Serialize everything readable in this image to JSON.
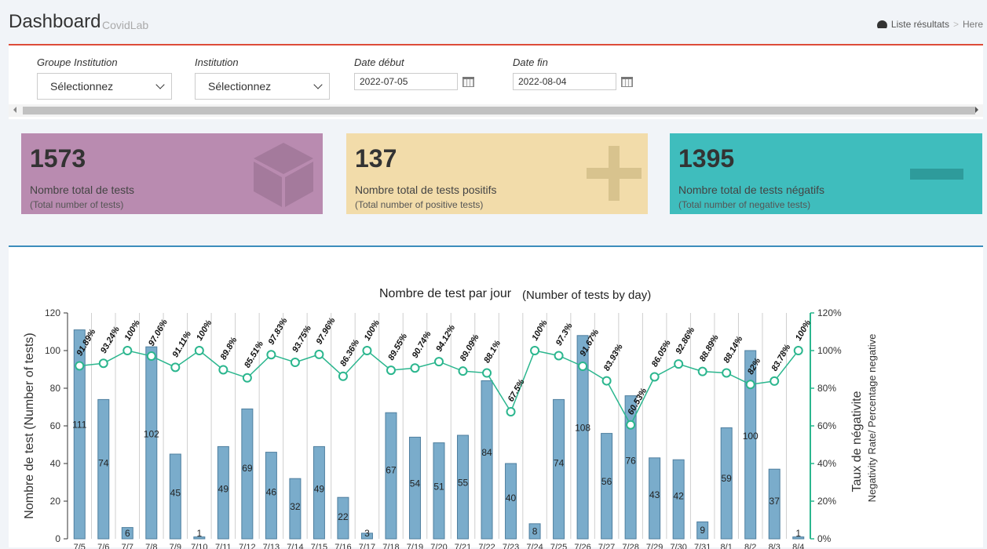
{
  "header": {
    "title": "Dashboard",
    "subtitle": "CovidLab",
    "breadcrumb": {
      "results_label": "Liste résultats",
      "separator": ">",
      "here_label": "Here"
    }
  },
  "filters": {
    "groupe_label": "Groupe Institution",
    "groupe_value": "Sélectionnez",
    "institution_label": "Institution",
    "institution_value": "Sélectionnez",
    "date_debut_label": "Date début",
    "date_debut_value": "2022-07-05",
    "date_fin_label": "Date fin",
    "date_fin_value": "2022-08-04"
  },
  "stats": {
    "total": {
      "value": "1573",
      "label": "Nombre total de tests",
      "sub": "(Total number of tests)",
      "color": "#b98bb0",
      "icon": "cube-icon"
    },
    "positive": {
      "value": "137",
      "label": "Nombre total de tests positifs",
      "sub": "(Total number of positive tests)",
      "color": "#f2dcaa",
      "icon": "plus-icon"
    },
    "negative": {
      "value": "1395",
      "label": "Nombre total de tests négatifs",
      "sub": "(Total number of negative tests)",
      "color": "#3fbdbd",
      "icon": "minus-icon"
    }
  },
  "chart_data": {
    "type": "bar",
    "title": "Nombre de test par jour",
    "subtitle": "(Number of tests by day)",
    "ylabel": "Nombre de test  (Number of tests)",
    "y2label": "Taux de négativite",
    "y2label_sub": "Negativity Rate/ Percentage negative",
    "ylim": [
      0,
      120
    ],
    "yticks": [
      "0",
      "20",
      "40",
      "60",
      "80",
      "100",
      "120"
    ],
    "y2lim": [
      0,
      120
    ],
    "y2ticks": [
      "0%",
      "20%",
      "40%",
      "60%",
      "80%",
      "100%",
      "120%"
    ],
    "categories": [
      "7/5",
      "7/6",
      "7/7",
      "7/8",
      "7/9",
      "7/10",
      "7/11",
      "7/12",
      "7/13",
      "7/14",
      "7/15",
      "7/16",
      "7/17",
      "7/18",
      "7/19",
      "7/20",
      "7/21",
      "7/22",
      "7/23",
      "7/24",
      "7/25",
      "7/26",
      "7/27",
      "7/28",
      "7/29",
      "7/30",
      "7/31",
      "8/1",
      "8/2",
      "8/3",
      "8/4"
    ],
    "series": [
      {
        "type": "bar",
        "values": [
          111,
          74,
          6,
          102,
          45,
          1,
          49,
          69,
          46,
          32,
          49,
          22,
          3,
          67,
          54,
          51,
          55,
          84,
          40,
          8,
          74,
          108,
          56,
          76,
          43,
          42,
          9,
          59,
          100,
          37,
          1
        ],
        "labels": [
          "111",
          "74",
          "6",
          "102",
          "45",
          "1",
          "49",
          "69",
          "46",
          "32",
          "49",
          "22",
          "3",
          "67",
          "54",
          "51",
          "55",
          "84",
          "40",
          "8",
          "74",
          "108",
          "56",
          "76",
          "43",
          "42",
          "9",
          "59",
          "100",
          "37",
          "1"
        ],
        "color": "#7aaccb"
      },
      {
        "type": "line",
        "axis": "right",
        "values": [
          91.89,
          93.24,
          100,
          97.06,
          91.11,
          100,
          89.8,
          85.51,
          97.83,
          93.75,
          97.96,
          86.36,
          100,
          89.55,
          90.74,
          94.12,
          89.09,
          88.1,
          67.5,
          100,
          97.3,
          91.67,
          83.93,
          60.53,
          86.05,
          92.86,
          88.89,
          88.14,
          82,
          83.78,
          100
        ],
        "labels": [
          "91.89%",
          "93.24%",
          "100%",
          "97.06%",
          "91.11%",
          "100%",
          "89.8%",
          "85.51%",
          "97.83%",
          "93.75%",
          "97.96%",
          "86.36%",
          "100%",
          "89.55%",
          "90.74%",
          "94.12%",
          "89.09%",
          "88.1%",
          "67.5%",
          "100%",
          "97.3%",
          "91.67%",
          "83.93%",
          "60.53%",
          "86.05%",
          "92.86%",
          "88.89%",
          "88.14%",
          "82%",
          "83.78%",
          "100%"
        ],
        "color": "#2bb68e"
      }
    ],
    "grid": "vertical",
    "legend": "none"
  }
}
